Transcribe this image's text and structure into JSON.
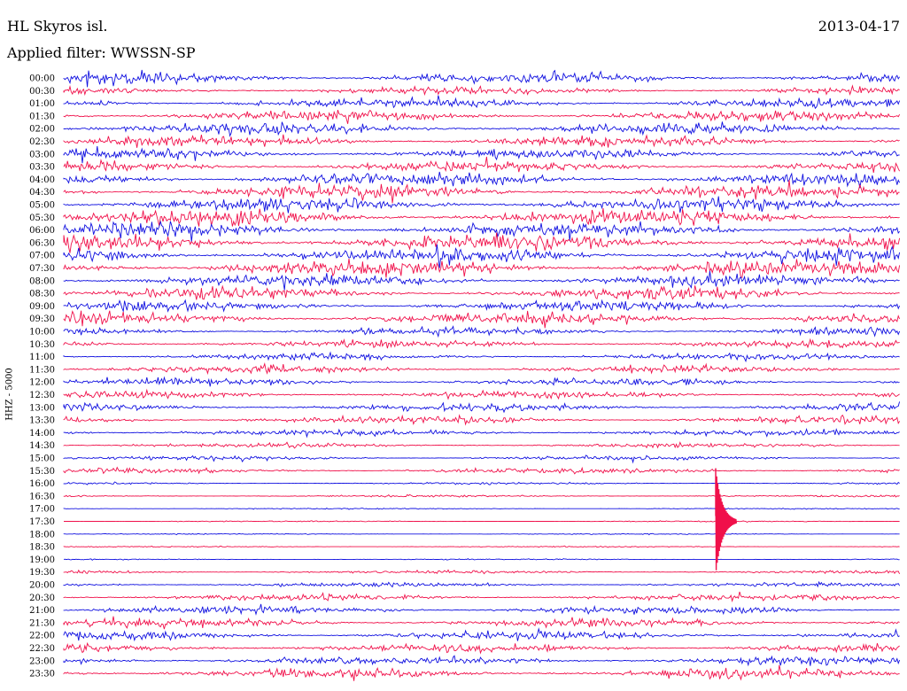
{
  "header": {
    "station": "HL Skyros isl.",
    "date": "2013-04-17",
    "filter": "Applied filter: WWSSN-SP"
  },
  "chart_data": {
    "type": "line",
    "title": "HL Skyros isl.",
    "ylabel": "HHZ - 5000",
    "ticks": [
      "00:00",
      "00:30",
      "01:00",
      "01:30",
      "02:00",
      "02:30",
      "03:00",
      "03:30",
      "04:00",
      "04:30",
      "05:00",
      "05:30",
      "06:00",
      "06:30",
      "07:00",
      "07:30",
      "08:00",
      "08:30",
      "09:00",
      "09:30",
      "10:00",
      "10:30",
      "11:00",
      "11:30",
      "12:00",
      "12:30",
      "13:00",
      "13:30",
      "14:00",
      "14:30",
      "15:00",
      "15:30",
      "16:00",
      "16:30",
      "17:00",
      "17:30",
      "18:00",
      "18:30",
      "19:00",
      "19:30",
      "20:00",
      "20:30",
      "21:00",
      "21:30",
      "22:00",
      "22:30",
      "23:00",
      "23:30"
    ],
    "trace_colors": [
      "#1010e0",
      "#f0104a"
    ],
    "noise_level": [
      10,
      7,
      9,
      10,
      11,
      10,
      10,
      10,
      12,
      12,
      13,
      14,
      14,
      15,
      14,
      15,
      12,
      11,
      10,
      12,
      7,
      7,
      6,
      7,
      7,
      7,
      7,
      7,
      6,
      4,
      4,
      5,
      2,
      2,
      1,
      1,
      1,
      1,
      1,
      3,
      4,
      6,
      7,
      8,
      8,
      8,
      8,
      9
    ],
    "events": [
      {
        "trace": "17:30",
        "at": "18:00 +",
        "label": "",
        "amplitude": "large"
      }
    ]
  }
}
